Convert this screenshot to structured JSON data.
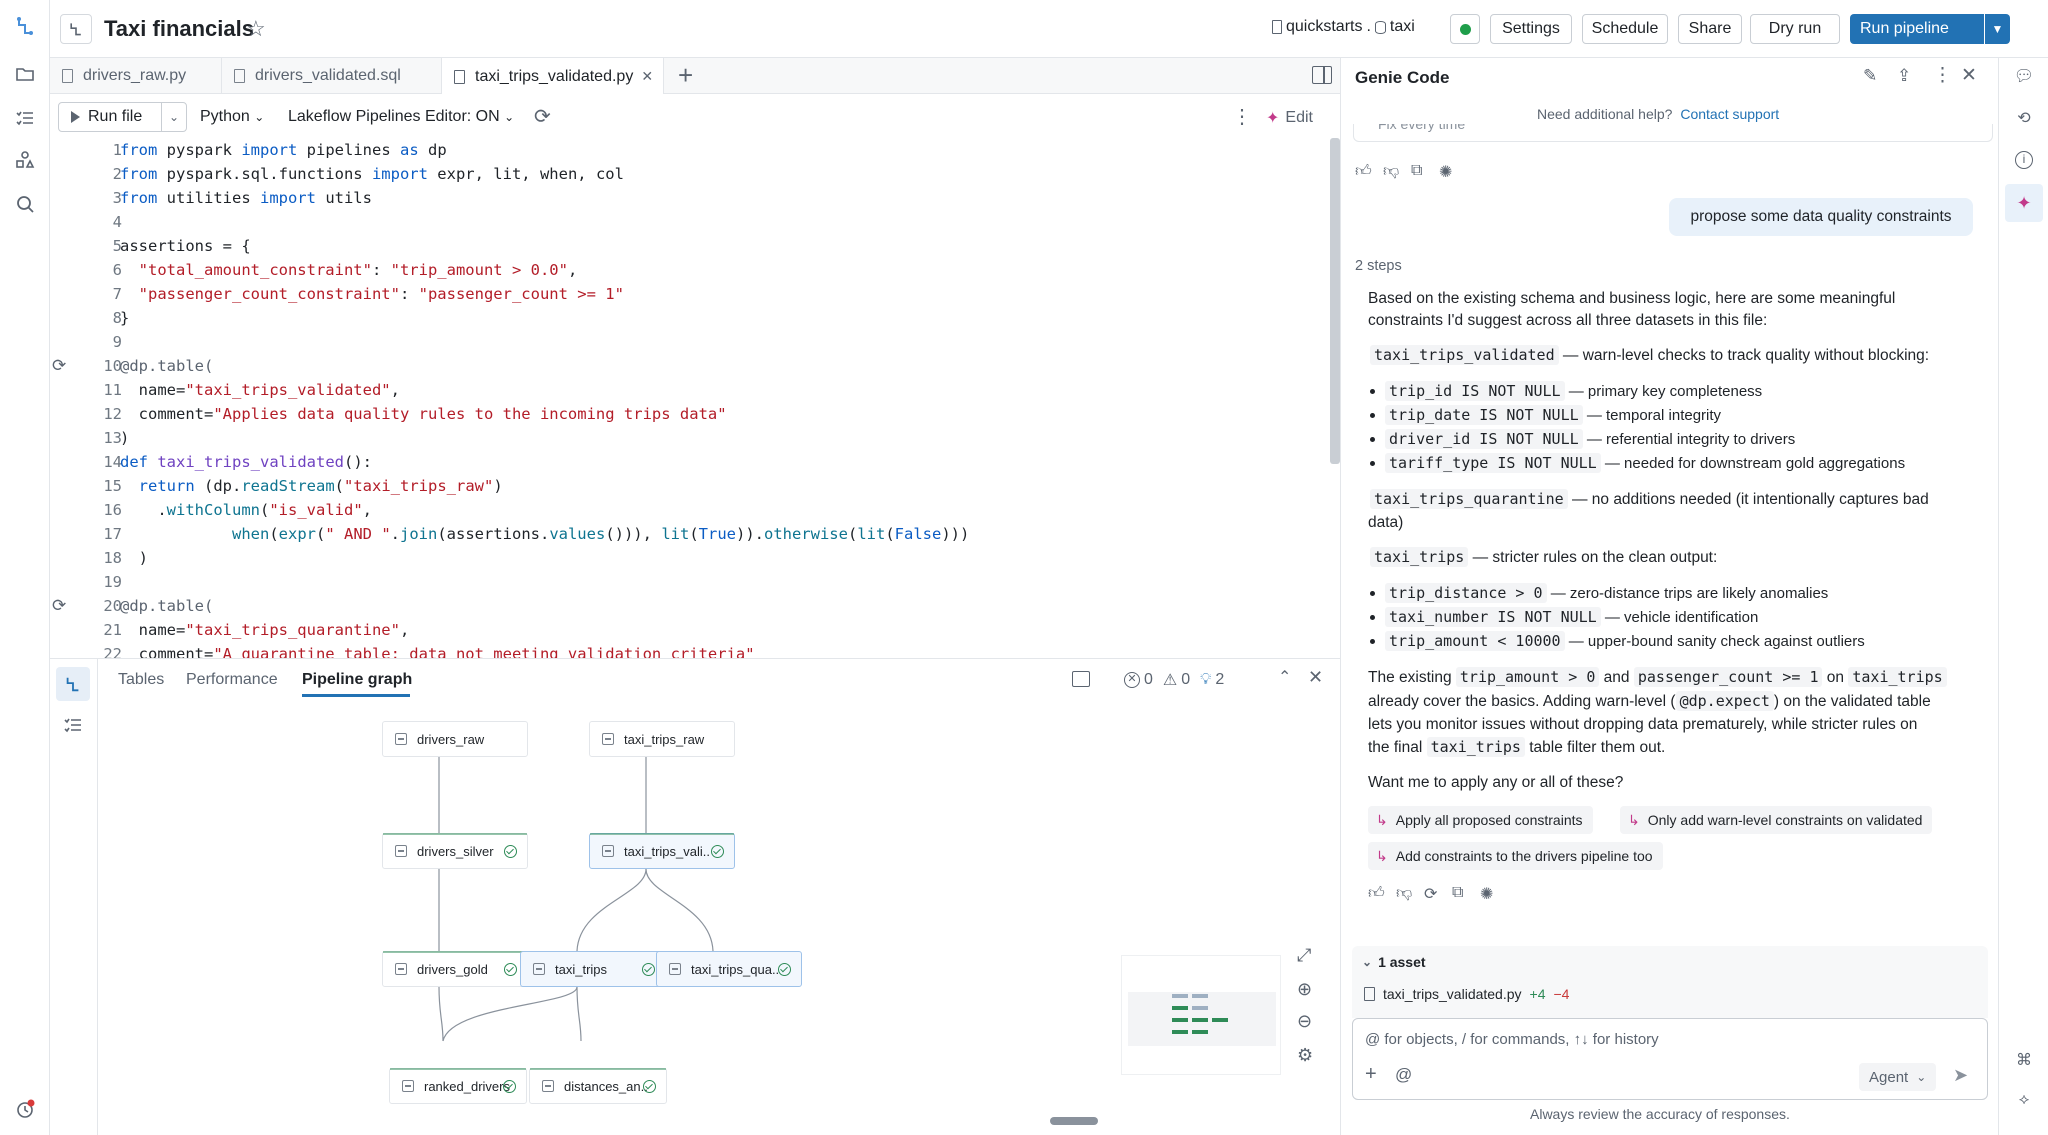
{
  "header": {
    "title": "Taxi financials",
    "catalog": "quickstarts",
    "schema": "taxi",
    "buttons": {
      "settings": "Settings",
      "schedule": "Schedule",
      "share": "Share",
      "dry_run": "Dry run",
      "run_pipeline": "Run pipeline"
    }
  },
  "tabs": [
    {
      "label": "drivers_raw.py"
    },
    {
      "label": "drivers_validated.sql"
    },
    {
      "label": "taxi_trips_validated.py"
    }
  ],
  "editor_toolbar": {
    "run_file": "Run file",
    "language": "Python",
    "editor_toggle": "Lakeflow Pipelines Editor: ON",
    "edit": "Edit"
  },
  "code": {
    "lines": [
      "1",
      "2",
      "3",
      "4",
      "5",
      "6",
      "7",
      "8",
      "9",
      "10",
      "11",
      "12",
      "13",
      "14",
      "15",
      "16",
      "17",
      "18",
      "19",
      "20",
      "21",
      "22"
    ]
  },
  "bottom": {
    "tabs": [
      "Tables",
      "Performance",
      "Pipeline graph"
    ],
    "active_tab": "Pipeline graph",
    "errors": "0",
    "warnings": "0",
    "suggestions": "2"
  },
  "graph": {
    "nodes": [
      "drivers_raw",
      "taxi_trips_raw",
      "drivers_silver",
      "taxi_trips_vali..",
      "drivers_gold",
      "taxi_trips",
      "taxi_trips_qua..",
      "ranked_drivers",
      "distances_an.."
    ]
  },
  "genie": {
    "title": "Genie Code",
    "help": "Need additional help?",
    "contact": "Contact support",
    "prev_partial": "Fix every time",
    "user_msg": "propose some data quality constraints",
    "steps": "2 steps",
    "intro": "Based on the existing schema and business logic, here are some meaningful constraints I'd suggest across all three datasets in this file:",
    "s1_code": "taxi_trips_validated",
    "s1_text": " — warn-level checks to track quality without blocking:",
    "s1_items": [
      {
        "code": "trip_id IS NOT NULL",
        "text": " — primary key completeness"
      },
      {
        "code": "trip_date IS NOT NULL",
        "text": " — temporal integrity"
      },
      {
        "code": "driver_id IS NOT NULL",
        "text": " — referential integrity to drivers"
      },
      {
        "code": "tariff_type IS NOT NULL",
        "text": " — needed for downstream gold aggregations"
      }
    ],
    "s2_code": "taxi_trips_quarantine",
    "s2_text_a": " — no additions needed (it intentionally captures bad",
    "s2_text_b": "data)",
    "s3_code": "taxi_trips",
    "s3_text": " — stricter rules on the clean output:",
    "s3_items": [
      {
        "code": "trip_distance > 0",
        "text": " — zero-distance trips are likely anomalies"
      },
      {
        "code": "taxi_number IS NOT NULL",
        "text": " — vehicle identification"
      },
      {
        "code": "trip_amount < 10000",
        "text": " — upper-bound sanity check against outliers"
      }
    ],
    "p1": "The existing",
    "p1_c1": "trip_amount > 0",
    "p1_and": "and",
    "p1_c2": "passenger_count >= 1",
    "p1_on": "on",
    "p1_c3": "taxi_trips",
    "p2": "already cover the basics. Adding warn-level (",
    "p2_c": "@dp.expect",
    "p2_b": ") on the validated table",
    "p3": "lets you monitor issues without dropping data prematurely, while stricter rules on",
    "p4a": "the final",
    "p4_c": "taxi_trips",
    "p4b": "table filter them out.",
    "question": "Want me to apply any or all of these?",
    "suggestions": [
      "Apply all proposed constraints",
      "Only add warn-level constraints on validated",
      "Add constraints to the drivers pipeline too"
    ],
    "asset_header": "1 asset",
    "asset_file": "taxi_trips_validated.py",
    "asset_add": "+4",
    "asset_del": "−4",
    "input_placeholder": "@ for objects, / for commands, ↑↓ for history",
    "agent": "Agent",
    "disclaimer": "Always review the accuracy of responses."
  }
}
